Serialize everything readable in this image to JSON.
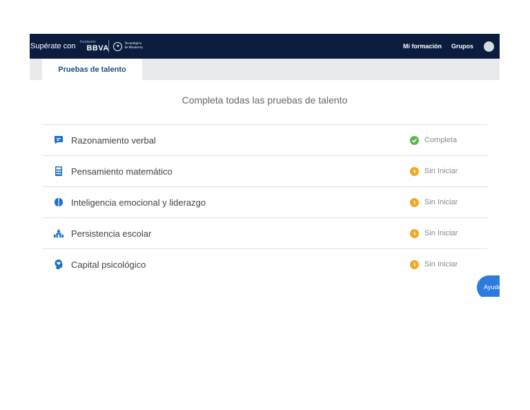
{
  "navbar": {
    "brand_text": "Supérate con",
    "bbva_fund": "Fundación",
    "bbva_word": "BBVA",
    "tec_line1": "Tecnológico",
    "tec_line2": "de Monterrey",
    "links": [
      {
        "label": "Mi formación"
      },
      {
        "label": "Grupos"
      }
    ],
    "background_color": "#0b1c3f"
  },
  "tabs": [
    {
      "label": "Pruebas de talento",
      "active": true
    }
  ],
  "main": {
    "title": "Completa todas las pruebas de talento",
    "tests": [
      {
        "label": "Razonamiento verbal",
        "icon": "speech-bubble-icon",
        "status": "Completa",
        "status_icon": "check-circle-icon",
        "status_color": "#5bb548"
      },
      {
        "label": "Pensamiento matemático",
        "icon": "calculator-icon",
        "status": "Sin Iniciar",
        "status_icon": "clock-icon",
        "status_color": "#f5a623"
      },
      {
        "label": "Inteligencia emocional y liderazgo",
        "icon": "brain-icon",
        "status": "Sin Iniciar",
        "status_icon": "clock-icon",
        "status_color": "#f5a623"
      },
      {
        "label": "Persistencia escolar",
        "icon": "school-icon",
        "status": "Sin Iniciar",
        "status_icon": "clock-icon",
        "status_color": "#f5a623"
      },
      {
        "label": "Capital psicológico",
        "icon": "head-heart-icon",
        "status": "Sin Iniciar",
        "status_icon": "clock-icon",
        "status_color": "#f5a623"
      }
    ]
  },
  "help_button": {
    "label": "Ayuda"
  },
  "colors": {
    "accent": "#1a6fc9",
    "tab_text": "#1a4d8c"
  }
}
